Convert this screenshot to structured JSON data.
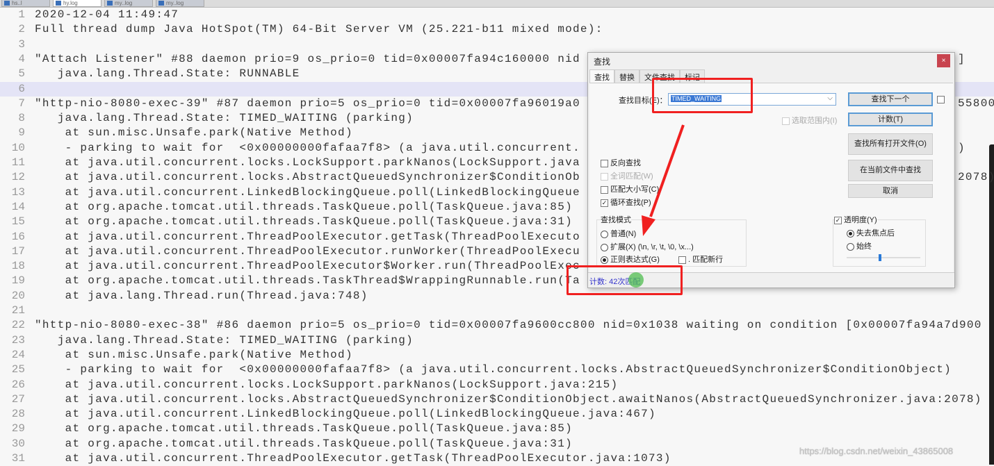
{
  "tabs": [
    "hs..l",
    "hy.log",
    "my..log",
    "my..log"
  ],
  "editor": {
    "current_line": 6,
    "lines": [
      "2020-12-04 11:49:47",
      "Full thread dump Java HotSpot(TM) 64-Bit Server VM (25.221-b11 mixed mode):",
      "",
      "\"Attach Listener\" #88 daemon prio=9 os_prio=0 tid=0x00007fa94c160000 nid",
      "   java.lang.Thread.State: RUNNABLE",
      "",
      "\"http-nio-8080-exec-39\" #87 daemon prio=5 os_prio=0 tid=0x00007fa96019a0",
      "   java.lang.Thread.State: TIMED_WAITING (parking)",
      "    at sun.misc.Unsafe.park(Native Method)",
      "    - parking to wait for  <0x00000000fafaa7f8> (a java.util.concurrent.",
      "    at java.util.concurrent.locks.LockSupport.parkNanos(LockSupport.java",
      "    at java.util.concurrent.locks.AbstractQueuedSynchronizer$ConditionOb",
      "    at java.util.concurrent.LinkedBlockingQueue.poll(LinkedBlockingQueue",
      "    at org.apache.tomcat.util.threads.TaskQueue.poll(TaskQueue.java:85)",
      "    at org.apache.tomcat.util.threads.TaskQueue.poll(TaskQueue.java:31)",
      "    at java.util.concurrent.ThreadPoolExecutor.getTask(ThreadPoolExecuto",
      "    at java.util.concurrent.ThreadPoolExecutor.runWorker(ThreadPoolExecu",
      "    at java.util.concurrent.ThreadPoolExecutor$Worker.run(ThreadPoolExec",
      "    at org.apache.tomcat.util.threads.TaskThread$WrappingRunnable.run(Ta",
      "    at java.lang.Thread.run(Thread.java:748)",
      "",
      "\"http-nio-8080-exec-38\" #86 daemon prio=5 os_prio=0 tid=0x00007fa9600cc800 nid=0x1038 waiting on condition [0x00007fa94a7d900",
      "   java.lang.Thread.State: TIMED_WAITING (parking)",
      "    at sun.misc.Unsafe.park(Native Method)",
      "    - parking to wait for  <0x00000000fafaa7f8> (a java.util.concurrent.locks.AbstractQueuedSynchronizer$ConditionObject)",
      "    at java.util.concurrent.locks.LockSupport.parkNanos(LockSupport.java:215)",
      "    at java.util.concurrent.locks.AbstractQueuedSynchronizer$ConditionObject.awaitNanos(AbstractQueuedSynchronizer.java:2078)",
      "    at java.util.concurrent.LinkedBlockingQueue.poll(LinkedBlockingQueue.java:467)",
      "    at org.apache.tomcat.util.threads.TaskQueue.poll(TaskQueue.java:85)",
      "    at org.apache.tomcat.util.threads.TaskQueue.poll(TaskQueue.java:31)",
      "    at java.util.concurrent.ThreadPoolExecutor.getTask(ThreadPoolExecutor.java:1073)"
    ],
    "right_fragments": [
      {
        "line": 4,
        "text": "]"
      },
      {
        "line": 7,
        "text": "55800"
      },
      {
        "line": 10,
        "text": ")"
      },
      {
        "line": 12,
        "text": "2078)"
      }
    ]
  },
  "dialog": {
    "title": "查找",
    "close": "×",
    "tabs": [
      "查找",
      "替换",
      "文件查找",
      "标记"
    ],
    "find_label": "查找目标(E)：",
    "find_value": "TIMED_WAITING",
    "in_selection": "选取范围内(I)",
    "buttons": {
      "find_next": "查找下一个",
      "count": "计数(T)",
      "find_all_open": "查找所有打开文件(O)",
      "find_current": "在当前文件中查找",
      "cancel": "取消"
    },
    "options": {
      "reverse": "反向查找",
      "whole_word": "全词匹配(W)",
      "match_case": "匹配大小写(C)",
      "wrap": "循环查找(P)"
    },
    "mode_title": "查找模式",
    "modes": {
      "normal": "普通(N)",
      "extended": "扩展(X) (\\n, \\r, \\t, \\0, \\x...)",
      "regex": "正则表达式(G)",
      "dot_newline": ". 匹配新行"
    },
    "selected_mode": "regex",
    "transparency": {
      "label": "透明度(Y)",
      "on_blur": "失去焦点后",
      "always": "始终",
      "level": 0.45
    },
    "status": "计数: 42次匹配"
  },
  "annotation_color": "#f02020",
  "watermark": "https://blog.csdn.net/weixin_43865008"
}
